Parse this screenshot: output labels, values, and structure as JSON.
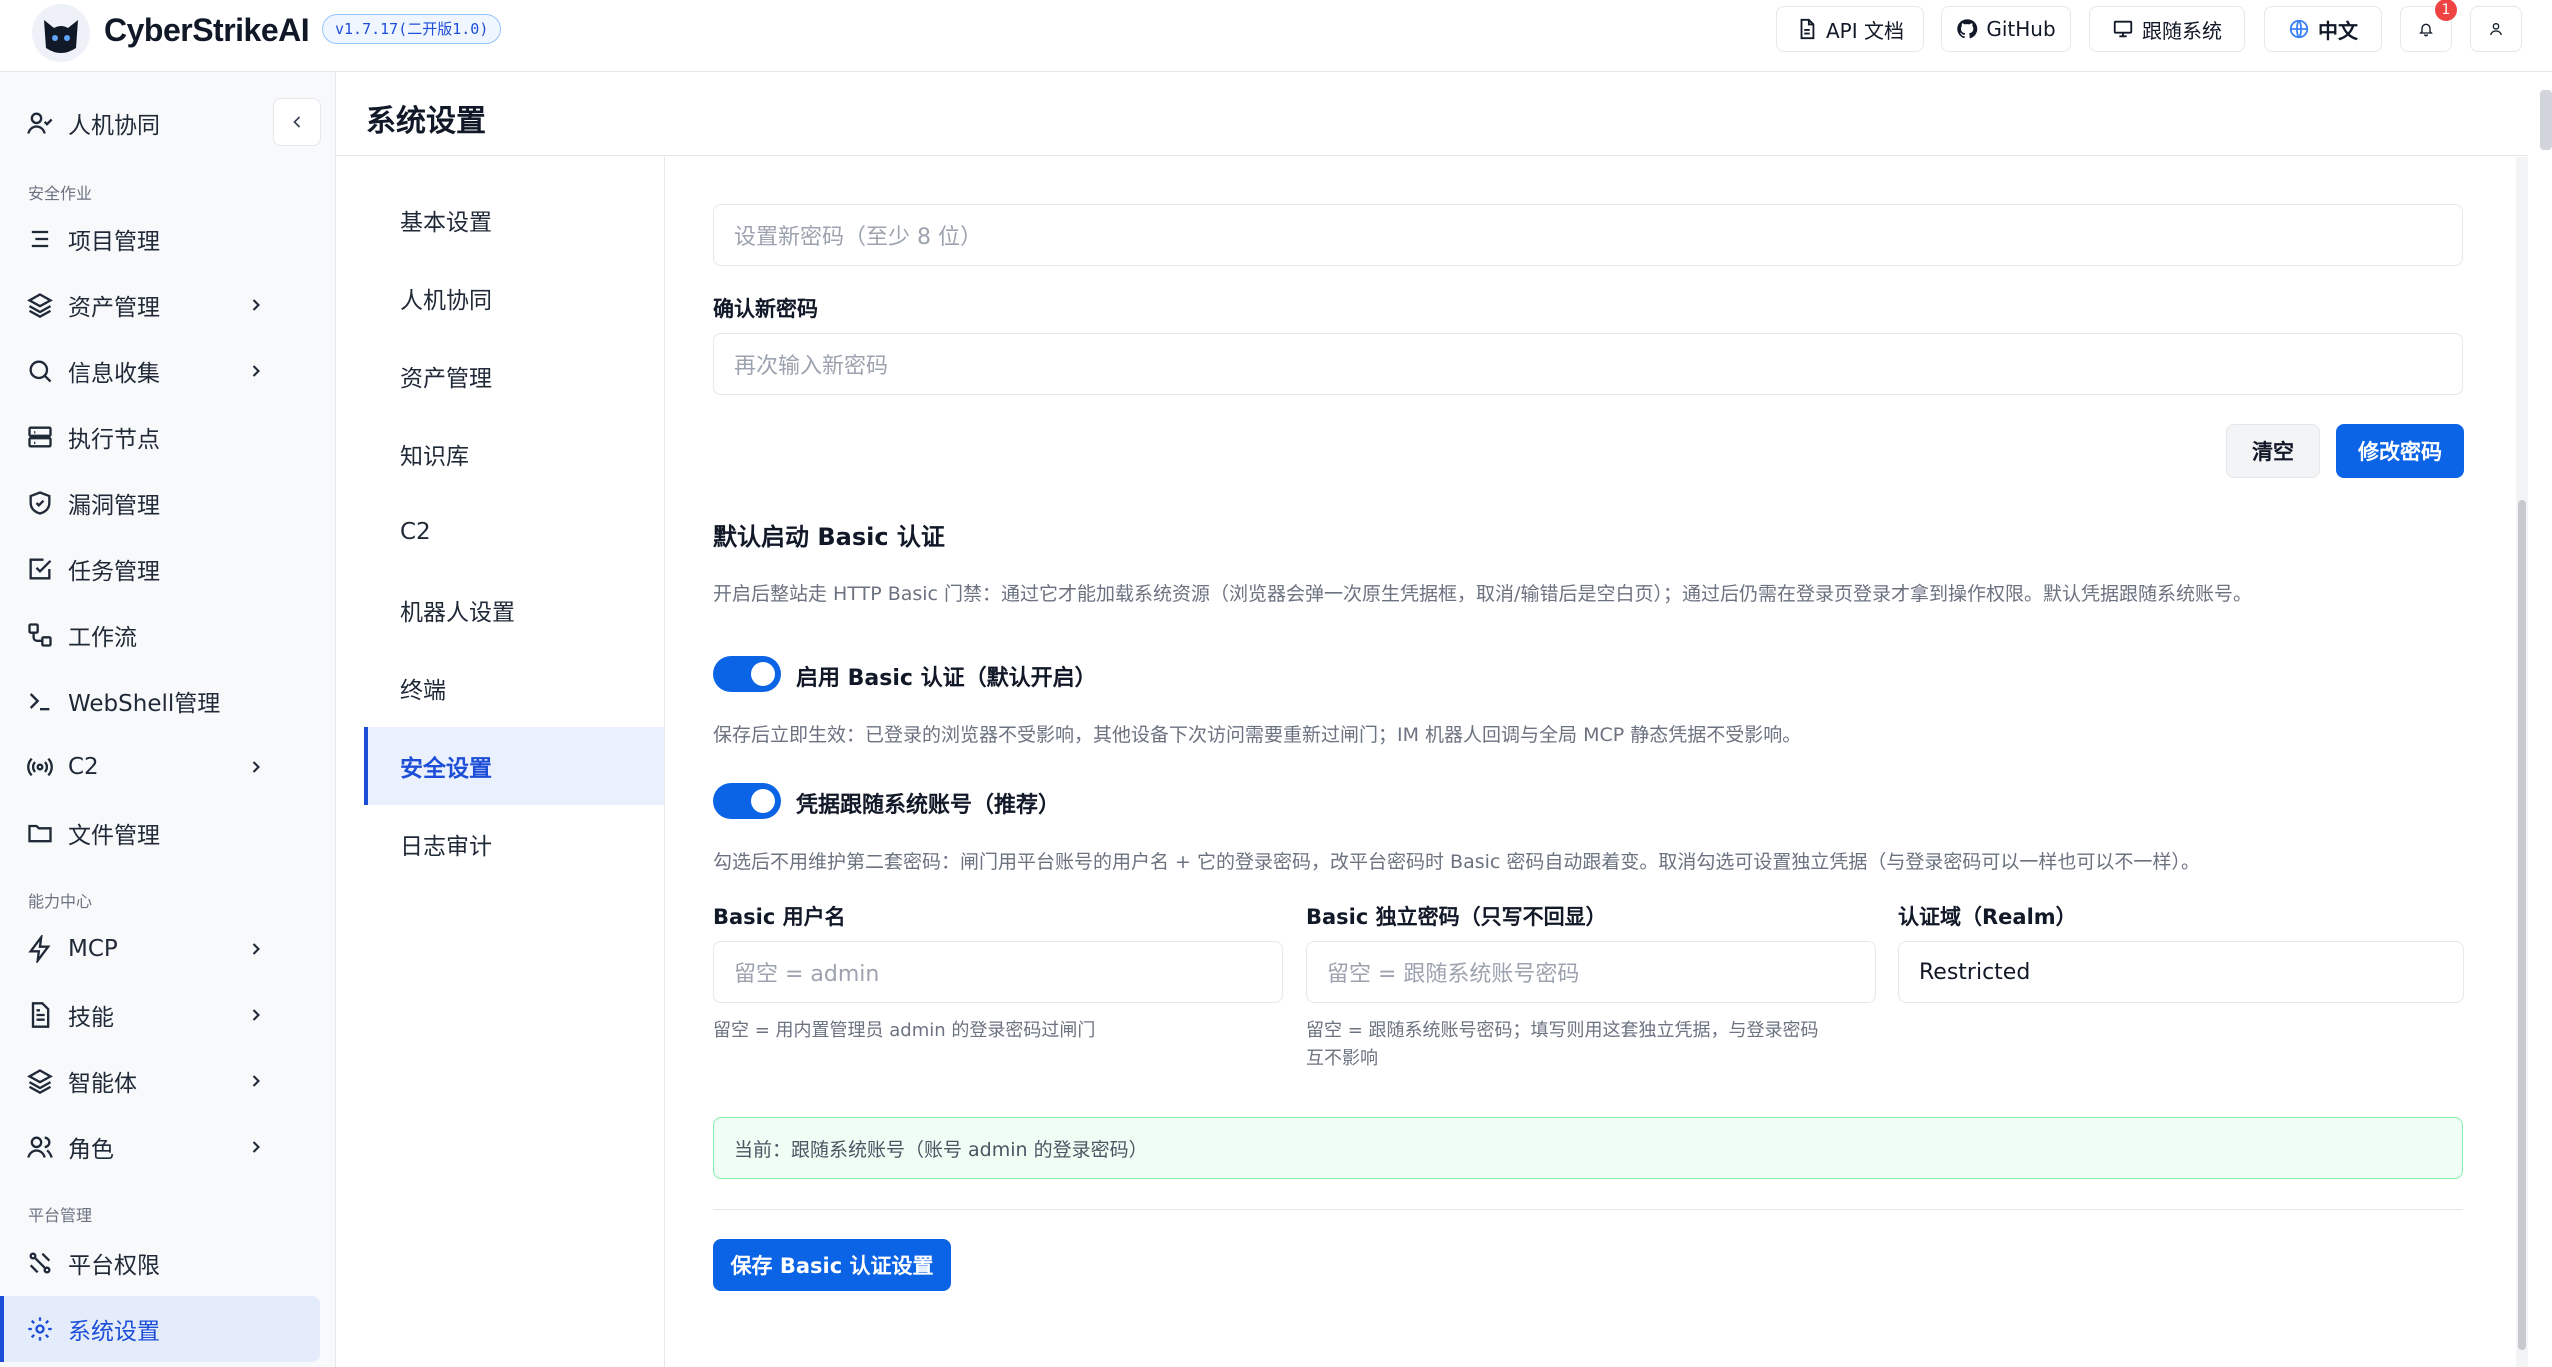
{
  "app": {
    "brand": "CyberStrikeAI",
    "version": "v1.7.17(二开版1.0)"
  },
  "topbar": {
    "api_docs": "API 文档",
    "github": "GitHub",
    "follow_system": "跟随系统",
    "language": "中文",
    "notification_count": "1"
  },
  "sidebar": {
    "human_collab": "人机协同",
    "section_security": "安全作业",
    "section_capability": "能力中心",
    "section_platform": "平台管理",
    "items": [
      {
        "label": "项目管理",
        "icon": "list-icon"
      },
      {
        "label": "资产管理",
        "icon": "layers-icon"
      },
      {
        "label": "信息收集",
        "icon": "search-icon"
      },
      {
        "label": "执行节点",
        "icon": "server-icon"
      },
      {
        "label": "漏洞管理",
        "icon": "shield-icon"
      },
      {
        "label": "任务管理",
        "icon": "checkbox-icon"
      },
      {
        "label": "工作流",
        "icon": "workflow-icon"
      },
      {
        "label": "WebShell管理",
        "icon": "terminal-icon"
      },
      {
        "label": "C2",
        "icon": "radio-icon"
      },
      {
        "label": "文件管理",
        "icon": "folder-icon"
      },
      {
        "label": "MCP",
        "icon": "bolt-icon"
      },
      {
        "label": "技能",
        "icon": "document-icon"
      },
      {
        "label": "智能体",
        "icon": "layers-icon"
      },
      {
        "label": "角色",
        "icon": "users-icon"
      },
      {
        "label": "平台权限",
        "icon": "permission-icon"
      },
      {
        "label": "系统设置",
        "icon": "gear-icon"
      }
    ]
  },
  "page": {
    "title": "系统设置"
  },
  "subnav": [
    "基本设置",
    "人机协同",
    "资产管理",
    "知识库",
    "C2",
    "机器人设置",
    "终端",
    "安全设置",
    "日志审计"
  ],
  "password": {
    "new_placeholder": "设置新密码（至少 8 位）",
    "confirm_label": "确认新密码",
    "confirm_placeholder": "再次输入新密码",
    "clear_button": "清空",
    "change_button": "修改密码"
  },
  "basic_auth": {
    "title": "默认启动 Basic 认证",
    "description": "开启后整站走 HTTP Basic 门禁：通过它才能加载系统资源（浏览器会弹一次原生凭据框，取消/输错后是空白页）；通过后仍需在登录页登录才拿到操作权限。默认凭据跟随系统账号。",
    "enable_label": "启用 Basic 认证（默认开启）",
    "enable_hint": "保存后立即生效：已登录的浏览器不受影响，其他设备下次访问需要重新过闸门；IM 机器人回调与全局 MCP 静态凭据不受影响。",
    "follow_label": "凭据跟随系统账号（推荐）",
    "follow_hint": "勾选后不用维护第二套密码：闸门用平台账号的用户名 + 它的登录密码，改平台密码时 Basic 密码自动跟着变。取消勾选可设置独立凭据（与登录密码可以一样也可以不一样）。",
    "username_label": "Basic 用户名",
    "username_placeholder": "留空 = admin",
    "username_hint": "留空 = 用内置管理员 admin 的登录密码过闸门",
    "password_label": "Basic 独立密码（只写不回显）",
    "password_placeholder": "留空 = 跟随系统账号密码",
    "password_hint_1": "留空 = 跟随系统账号密码；填写则用这套独立凭据，与登录密码",
    "password_hint_2": "互不影响",
    "realm_label": "认证域（Realm）",
    "realm_value": "Restricted",
    "status": "当前：跟随系统账号（账号 admin 的登录密码）",
    "save_button": "保存 Basic 认证设置"
  },
  "colors": {
    "primary": "#0b63e5",
    "active_bg": "#e4ecfb",
    "status_border": "#86efac",
    "badge": "#ef4444"
  }
}
